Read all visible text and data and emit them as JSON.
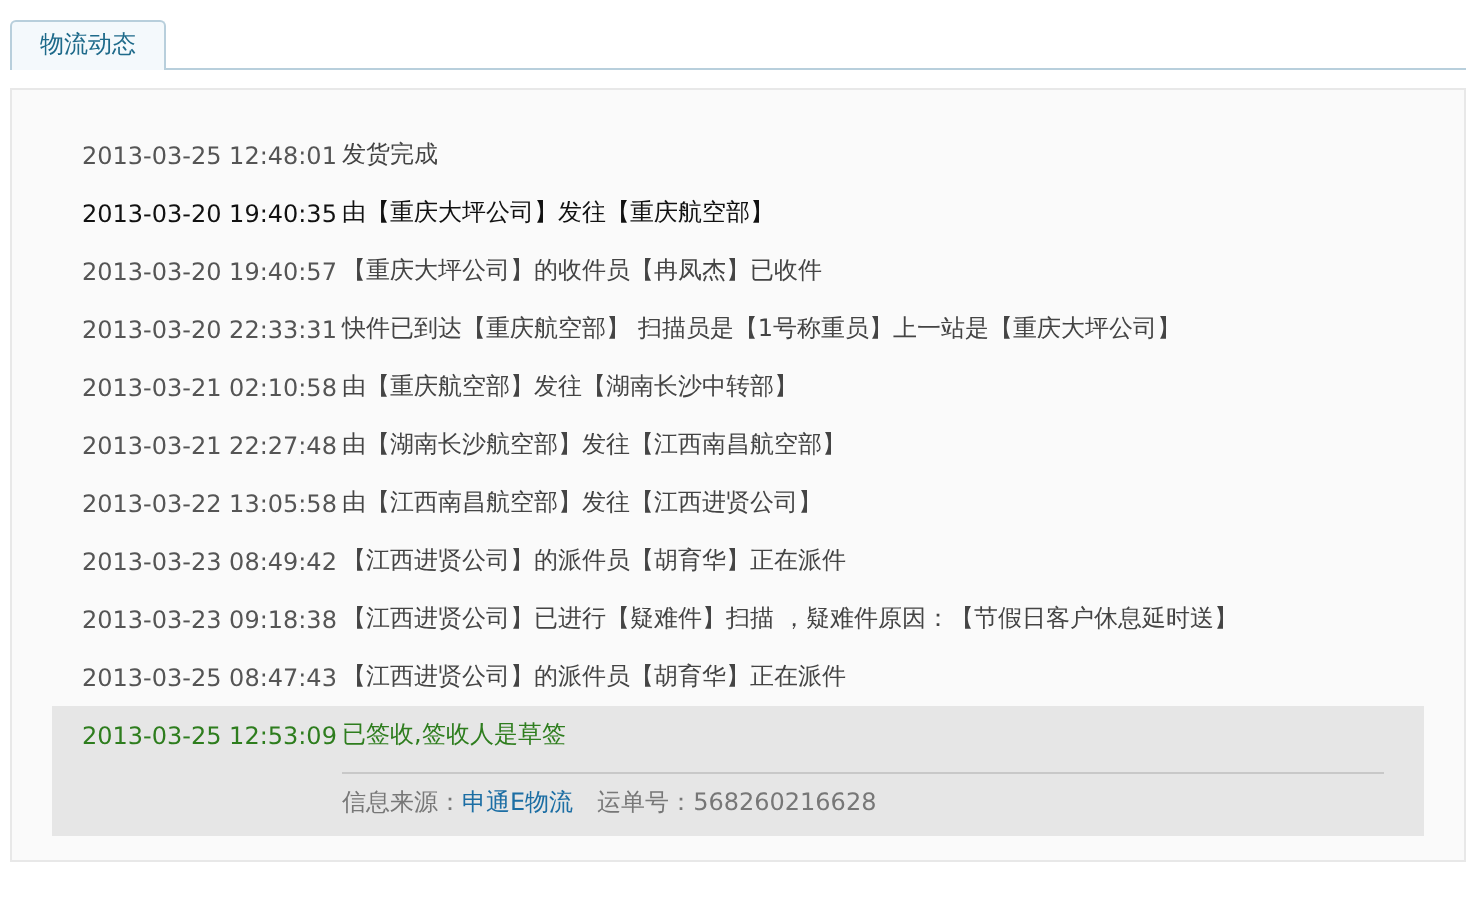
{
  "tabs": [
    {
      "label": "物流动态",
      "selected": true
    }
  ],
  "events": [
    {
      "time": "2013-03-25 12:48:01",
      "text": "发货完成",
      "kind": "normal"
    },
    {
      "time": "2013-03-20 19:40:35",
      "text": "由【重庆大坪公司】发往【重庆航空部】",
      "kind": "bold"
    },
    {
      "time": "2013-03-20 19:40:57",
      "text": "【重庆大坪公司】的收件员【冉凤杰】已收件",
      "kind": "normal"
    },
    {
      "time": "2013-03-20 22:33:31",
      "text": "快件已到达【重庆航空部】 扫描员是【1号称重员】上一站是【重庆大坪公司】",
      "kind": "normal"
    },
    {
      "time": "2013-03-21 02:10:58",
      "text": "由【重庆航空部】发往【湖南长沙中转部】",
      "kind": "normal"
    },
    {
      "time": "2013-03-21 22:27:48",
      "text": "由【湖南长沙航空部】发往【江西南昌航空部】",
      "kind": "normal"
    },
    {
      "time": "2013-03-22 13:05:58",
      "text": "由【江西南昌航空部】发往【江西进贤公司】",
      "kind": "normal"
    },
    {
      "time": "2013-03-23 08:49:42",
      "text": "【江西进贤公司】的派件员【胡育华】正在派件",
      "kind": "normal"
    },
    {
      "time": "2013-03-23 09:18:38",
      "text": "【江西进贤公司】已进行【疑难件】扫描 ，疑难件原因：【节假日客户休息延时送】",
      "kind": "normal"
    },
    {
      "time": "2013-03-25 08:47:43",
      "text": "【江西进贤公司】的派件员【胡育华】正在派件",
      "kind": "normal"
    },
    {
      "time": "2013-03-25 12:53:09",
      "text": "已签收,签收人是草签",
      "kind": "latest"
    }
  ],
  "source": {
    "label": "信息来源：",
    "link": "申通E物流",
    "waybill": "运单号：568260216628"
  }
}
